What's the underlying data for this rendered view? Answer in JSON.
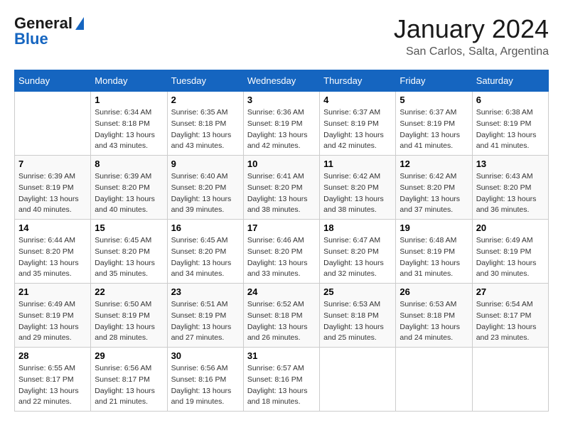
{
  "logo": {
    "line1": "General",
    "line2": "Blue"
  },
  "title": "January 2024",
  "subtitle": "San Carlos, Salta, Argentina",
  "days_of_week": [
    "Sunday",
    "Monday",
    "Tuesday",
    "Wednesday",
    "Thursday",
    "Friday",
    "Saturday"
  ],
  "weeks": [
    [
      {
        "day": "",
        "info": ""
      },
      {
        "day": "1",
        "info": "Sunrise: 6:34 AM\nSunset: 8:18 PM\nDaylight: 13 hours\nand 43 minutes."
      },
      {
        "day": "2",
        "info": "Sunrise: 6:35 AM\nSunset: 8:18 PM\nDaylight: 13 hours\nand 43 minutes."
      },
      {
        "day": "3",
        "info": "Sunrise: 6:36 AM\nSunset: 8:19 PM\nDaylight: 13 hours\nand 42 minutes."
      },
      {
        "day": "4",
        "info": "Sunrise: 6:37 AM\nSunset: 8:19 PM\nDaylight: 13 hours\nand 42 minutes."
      },
      {
        "day": "5",
        "info": "Sunrise: 6:37 AM\nSunset: 8:19 PM\nDaylight: 13 hours\nand 41 minutes."
      },
      {
        "day": "6",
        "info": "Sunrise: 6:38 AM\nSunset: 8:19 PM\nDaylight: 13 hours\nand 41 minutes."
      }
    ],
    [
      {
        "day": "7",
        "info": "Sunrise: 6:39 AM\nSunset: 8:19 PM\nDaylight: 13 hours\nand 40 minutes."
      },
      {
        "day": "8",
        "info": "Sunrise: 6:39 AM\nSunset: 8:20 PM\nDaylight: 13 hours\nand 40 minutes."
      },
      {
        "day": "9",
        "info": "Sunrise: 6:40 AM\nSunset: 8:20 PM\nDaylight: 13 hours\nand 39 minutes."
      },
      {
        "day": "10",
        "info": "Sunrise: 6:41 AM\nSunset: 8:20 PM\nDaylight: 13 hours\nand 38 minutes."
      },
      {
        "day": "11",
        "info": "Sunrise: 6:42 AM\nSunset: 8:20 PM\nDaylight: 13 hours\nand 38 minutes."
      },
      {
        "day": "12",
        "info": "Sunrise: 6:42 AM\nSunset: 8:20 PM\nDaylight: 13 hours\nand 37 minutes."
      },
      {
        "day": "13",
        "info": "Sunrise: 6:43 AM\nSunset: 8:20 PM\nDaylight: 13 hours\nand 36 minutes."
      }
    ],
    [
      {
        "day": "14",
        "info": "Sunrise: 6:44 AM\nSunset: 8:20 PM\nDaylight: 13 hours\nand 35 minutes."
      },
      {
        "day": "15",
        "info": "Sunrise: 6:45 AM\nSunset: 8:20 PM\nDaylight: 13 hours\nand 35 minutes."
      },
      {
        "day": "16",
        "info": "Sunrise: 6:45 AM\nSunset: 8:20 PM\nDaylight: 13 hours\nand 34 minutes."
      },
      {
        "day": "17",
        "info": "Sunrise: 6:46 AM\nSunset: 8:20 PM\nDaylight: 13 hours\nand 33 minutes."
      },
      {
        "day": "18",
        "info": "Sunrise: 6:47 AM\nSunset: 8:20 PM\nDaylight: 13 hours\nand 32 minutes."
      },
      {
        "day": "19",
        "info": "Sunrise: 6:48 AM\nSunset: 8:19 PM\nDaylight: 13 hours\nand 31 minutes."
      },
      {
        "day": "20",
        "info": "Sunrise: 6:49 AM\nSunset: 8:19 PM\nDaylight: 13 hours\nand 30 minutes."
      }
    ],
    [
      {
        "day": "21",
        "info": "Sunrise: 6:49 AM\nSunset: 8:19 PM\nDaylight: 13 hours\nand 29 minutes."
      },
      {
        "day": "22",
        "info": "Sunrise: 6:50 AM\nSunset: 8:19 PM\nDaylight: 13 hours\nand 28 minutes."
      },
      {
        "day": "23",
        "info": "Sunrise: 6:51 AM\nSunset: 8:19 PM\nDaylight: 13 hours\nand 27 minutes."
      },
      {
        "day": "24",
        "info": "Sunrise: 6:52 AM\nSunset: 8:18 PM\nDaylight: 13 hours\nand 26 minutes."
      },
      {
        "day": "25",
        "info": "Sunrise: 6:53 AM\nSunset: 8:18 PM\nDaylight: 13 hours\nand 25 minutes."
      },
      {
        "day": "26",
        "info": "Sunrise: 6:53 AM\nSunset: 8:18 PM\nDaylight: 13 hours\nand 24 minutes."
      },
      {
        "day": "27",
        "info": "Sunrise: 6:54 AM\nSunset: 8:17 PM\nDaylight: 13 hours\nand 23 minutes."
      }
    ],
    [
      {
        "day": "28",
        "info": "Sunrise: 6:55 AM\nSunset: 8:17 PM\nDaylight: 13 hours\nand 22 minutes."
      },
      {
        "day": "29",
        "info": "Sunrise: 6:56 AM\nSunset: 8:17 PM\nDaylight: 13 hours\nand 21 minutes."
      },
      {
        "day": "30",
        "info": "Sunrise: 6:56 AM\nSunset: 8:16 PM\nDaylight: 13 hours\nand 19 minutes."
      },
      {
        "day": "31",
        "info": "Sunrise: 6:57 AM\nSunset: 8:16 PM\nDaylight: 13 hours\nand 18 minutes."
      },
      {
        "day": "",
        "info": ""
      },
      {
        "day": "",
        "info": ""
      },
      {
        "day": "",
        "info": ""
      }
    ]
  ]
}
